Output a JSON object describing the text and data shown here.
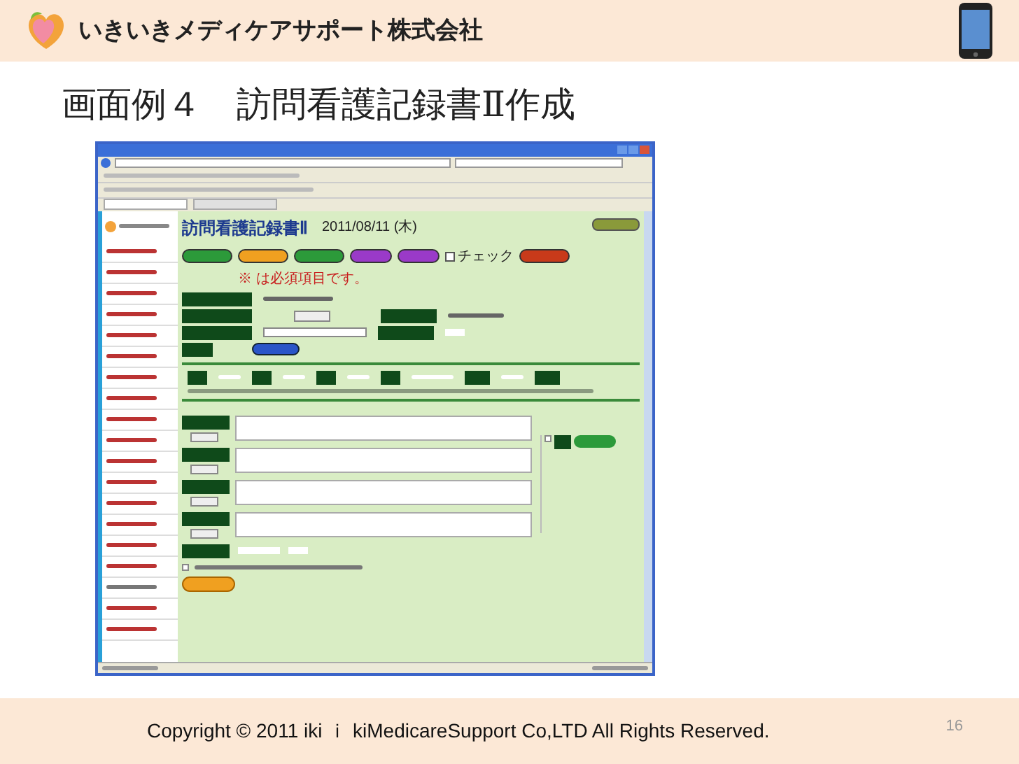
{
  "header": {
    "company": "いきいきメディケアサポート株式会社"
  },
  "title": "画面例４　訪問看護記録書Ⅱ作成",
  "screenshot": {
    "heading": "訪問看護記録書Ⅱ",
    "date": "2011/08/11 (木)",
    "required_note": "※ は必須項目です。",
    "check": {
      "label": "チェック",
      "checked": false
    },
    "insert_check": {
      "checked": false
    },
    "done_check": {
      "checked": false
    }
  },
  "footer": {
    "copyright": "Copyright © 2011 iki ｉ kiMedicareSupport Co,LTD All Rights Reserved.",
    "page": "16"
  }
}
